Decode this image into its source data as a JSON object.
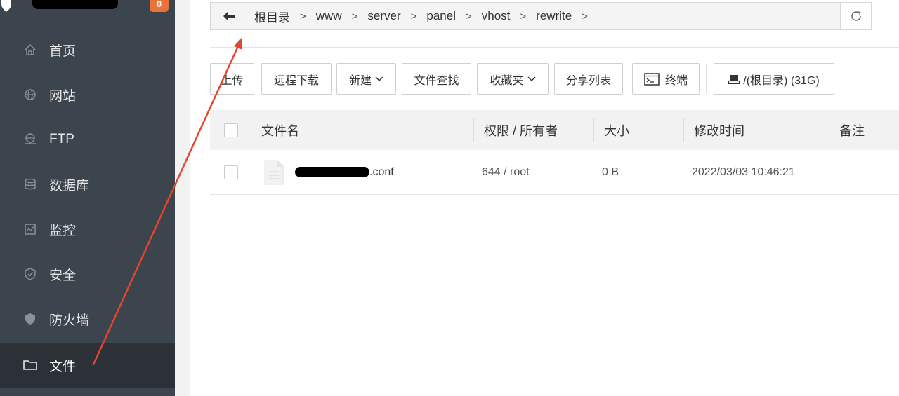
{
  "sidebar": {
    "badge": "0",
    "items": [
      {
        "label": "首页",
        "icon": "home-icon"
      },
      {
        "label": "网站",
        "icon": "globe-icon"
      },
      {
        "label": "FTP",
        "icon": "ftp-icon"
      },
      {
        "label": "数据库",
        "icon": "database-icon"
      },
      {
        "label": "监控",
        "icon": "monitor-icon"
      },
      {
        "label": "安全",
        "icon": "shield-check-icon"
      },
      {
        "label": "防火墙",
        "icon": "firewall-shield-icon"
      },
      {
        "label": "文件",
        "icon": "folder-icon",
        "active": true
      }
    ]
  },
  "breadcrumb": {
    "items": [
      "根目录",
      "www",
      "server",
      "panel",
      "vhost",
      "rewrite"
    ]
  },
  "toolbar": {
    "upload": "上传",
    "remote_download": "远程下载",
    "new": "新建",
    "file_search": "文件查找",
    "favorites": "收藏夹",
    "share_list": "分享列表",
    "terminal": "终端",
    "disk": "/(根目录) (31G)"
  },
  "table": {
    "headers": {
      "name": "文件名",
      "permission": "权限 / 所有者",
      "size": "大小",
      "modified": "修改时间",
      "remark": "备注"
    },
    "rows": [
      {
        "name_suffix": ".conf",
        "permission": "644 / root",
        "size": "0 B",
        "modified": "2022/03/03 10:46:21",
        "remark": ""
      }
    ]
  },
  "colors": {
    "sidebar_bg": "#3c444d",
    "sidebar_active_bg": "#2c3137",
    "badge": "#e9733a",
    "annotation_arrow": "#e5452f"
  }
}
